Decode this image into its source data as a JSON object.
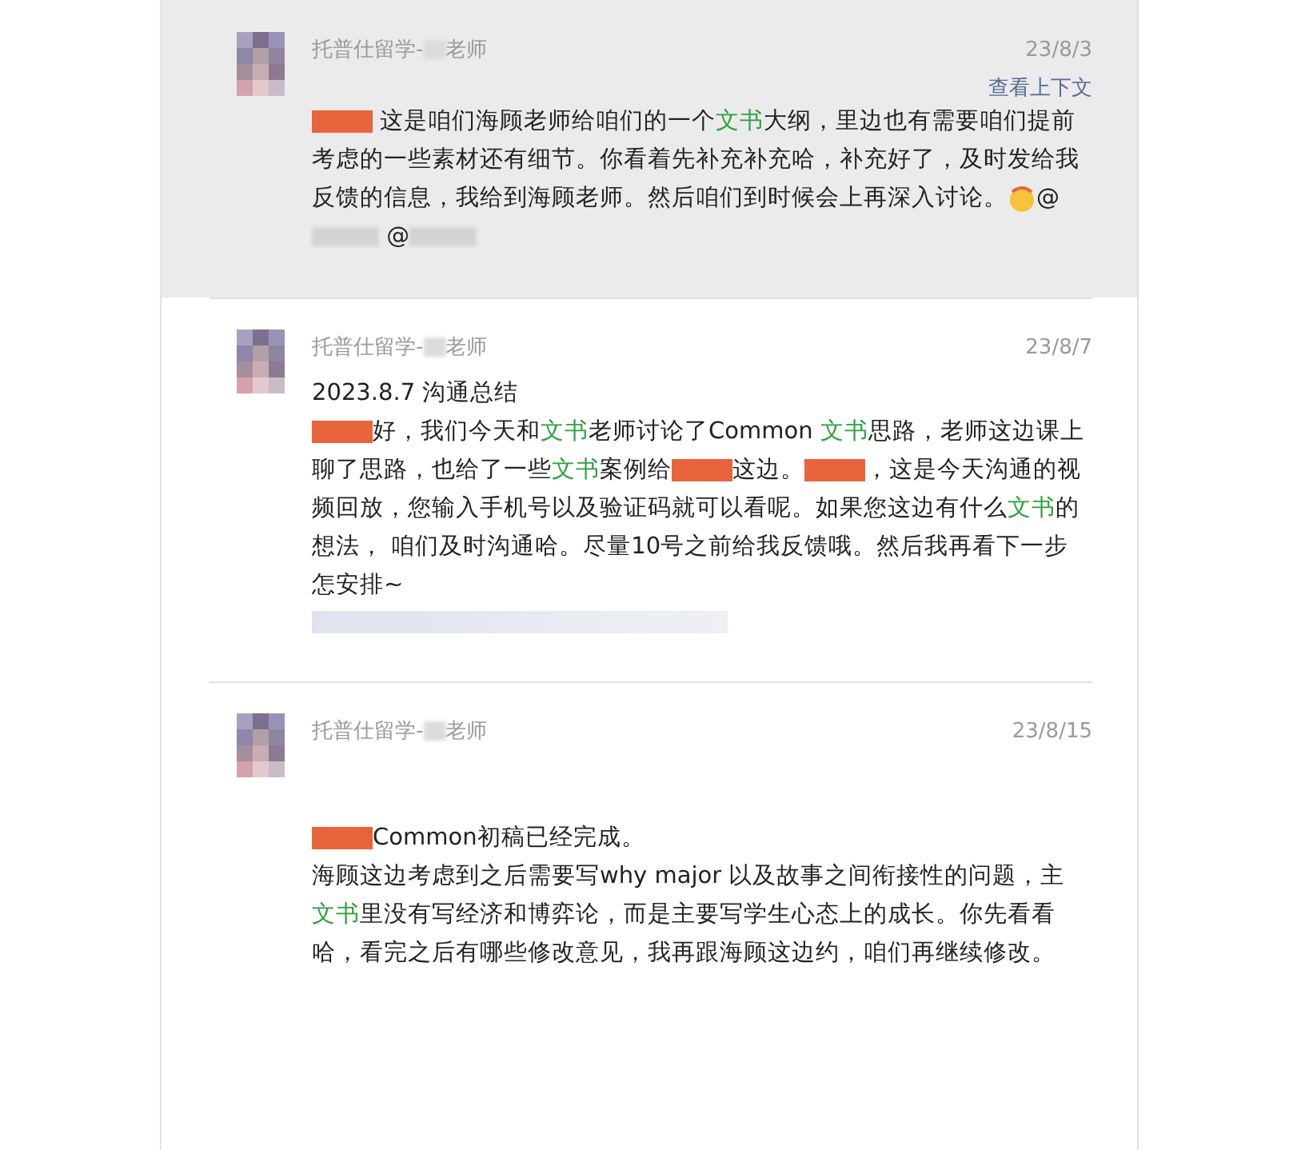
{
  "messages": [
    {
      "selected": true,
      "sender": [
        {
          "kind": "text",
          "text": "托普仕留学-"
        },
        {
          "kind": "blur"
        },
        {
          "kind": "text",
          "text": "老师"
        }
      ],
      "date": "23/8/3",
      "context_link": "查看上下文",
      "lines": [
        [
          {
            "kind": "redact"
          },
          {
            "kind": "text",
            "text": " 这是咱们海顾老师给咱们的一个"
          },
          {
            "kind": "hl",
            "text": "文书"
          },
          {
            "kind": "text",
            "text": "大纲，里边也有需要咱们提前考虑的一些素材还有细节。你看着先补充补充哈，补充好了，及时发给我反馈的信息，我给到海顾老师。然后咱们到时候会上再深入讨论。"
          },
          {
            "kind": "emoji"
          },
          {
            "kind": "text",
            "text": "@"
          },
          {
            "kind": "blur"
          },
          {
            "kind": "text",
            "text": " @"
          },
          {
            "kind": "blur"
          }
        ]
      ]
    },
    {
      "selected": false,
      "sender": [
        {
          "kind": "text",
          "text": "托普仕留学-"
        },
        {
          "kind": "blur"
        },
        {
          "kind": "text",
          "text": "老师"
        }
      ],
      "date": "23/8/7",
      "lines": [
        [
          {
            "kind": "text",
            "text": "2023.8.7 沟通总结"
          }
        ],
        [
          {
            "kind": "redact"
          },
          {
            "kind": "text",
            "text": "好，我们今天和"
          },
          {
            "kind": "hl",
            "text": "文书"
          },
          {
            "kind": "text",
            "text": "老师讨论了Common "
          },
          {
            "kind": "hl",
            "text": "文书"
          },
          {
            "kind": "text",
            "text": "思路，老师这边课上聊了思路，也给了一些"
          },
          {
            "kind": "hl",
            "text": "文书"
          },
          {
            "kind": "text",
            "text": "案例给"
          },
          {
            "kind": "redact"
          },
          {
            "kind": "text",
            "text": "这边。"
          },
          {
            "kind": "redact"
          },
          {
            "kind": "text",
            "text": "，这是今天沟通的视频回放，您输入手机号以及验证码就可以看呢。如果您这边有什么"
          },
          {
            "kind": "hl",
            "text": "文书"
          },
          {
            "kind": "text",
            "text": "的想法， 咱们及时沟通哈。尽量10号之前给我反馈哦。然后我再看下一步怎安排~"
          }
        ],
        [
          {
            "kind": "blurline"
          }
        ]
      ]
    },
    {
      "selected": false,
      "sender": [
        {
          "kind": "text",
          "text": "托普仕留学-"
        },
        {
          "kind": "blur"
        },
        {
          "kind": "text",
          "text": "老师"
        }
      ],
      "date": "23/8/15",
      "lines": [
        [
          {
            "kind": "redact"
          },
          {
            "kind": "text",
            "text": "Common初稿已经完成。"
          }
        ],
        [
          {
            "kind": "text",
            "text": "海顾这边考虑到之后需要写why major 以及故事之间衔接性的问题，主"
          },
          {
            "kind": "hl",
            "text": "文书"
          },
          {
            "kind": "text",
            "text": "里没有写经济和博弈论，而是主要写学生心态上的成长。你先看看哈，看完之后有哪些修改意见，我再跟海顾这边约，咱们再继续修改。"
          }
        ]
      ]
    }
  ]
}
